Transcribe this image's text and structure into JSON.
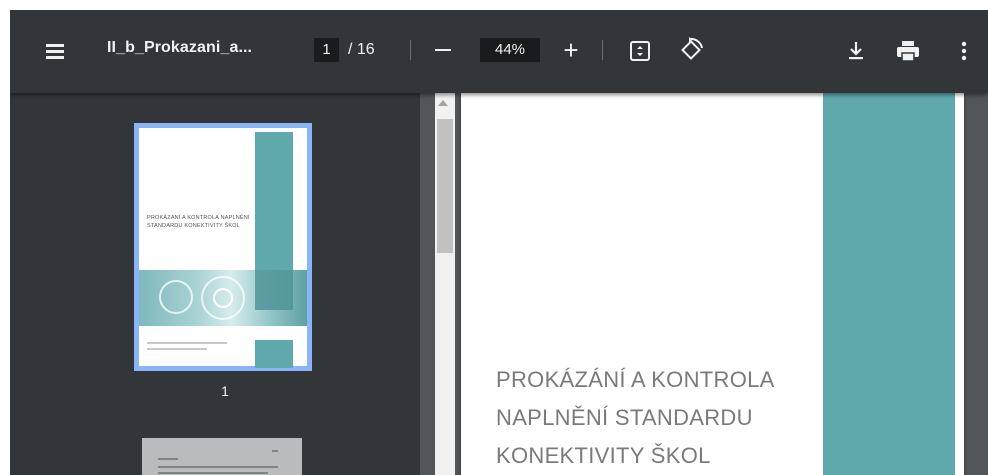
{
  "toolbar": {
    "title": "II_b_Prokazani_a...",
    "page_current": "1",
    "page_total": "/ 16",
    "zoom": "44%",
    "zoom_in_glyph": "+"
  },
  "sidebar": {
    "thumbnails": [
      {
        "label": "1",
        "title_text": "PROKÁZÁNÍ A KONTROLA NAPLNĚNÍ STANDARDU KONEKTIVITY ŠKOL"
      }
    ]
  },
  "page": {
    "title_lines": [
      "PROKÁZÁNÍ A KONTROLA",
      "NAPLNĚNÍ STANDARDU",
      "KONEKTIVITY ŠKOL"
    ]
  },
  "colors": {
    "toolbar_bg": "#323639",
    "viewer_bg": "#525659",
    "accent_teal": "#5fa9ad",
    "thumb_selected": "#8ab4f8"
  }
}
